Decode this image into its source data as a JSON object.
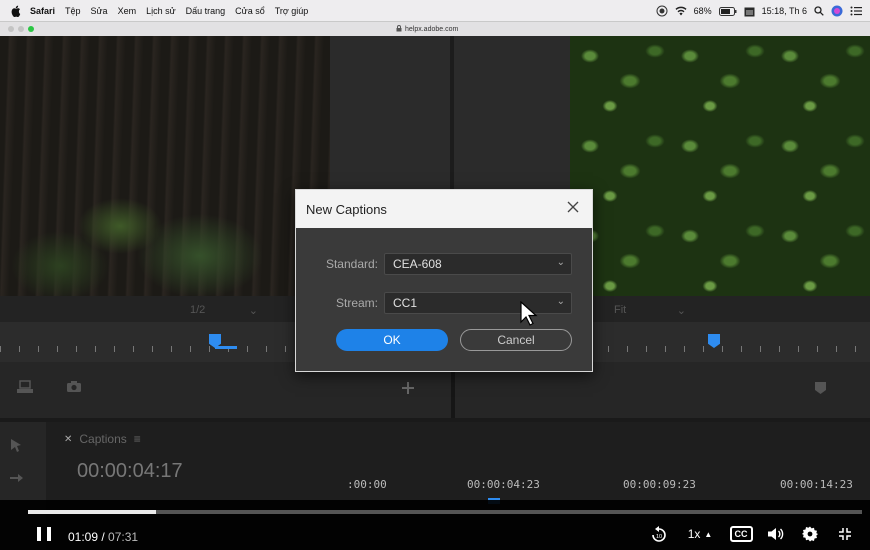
{
  "menubar": {
    "app": "Safari",
    "items": [
      "Tệp",
      "Sửa",
      "Xem",
      "Lịch sử",
      "Dấu trang",
      "Cửa sổ",
      "Trợ giúp"
    ],
    "battery": "68%",
    "clock": "15:18, Th 6"
  },
  "browser": {
    "url": "helpx.adobe.com"
  },
  "editor": {
    "scale_select": "1/2",
    "fit_select": "Fit",
    "captions_tab": "Captions",
    "timecode": "00:00:04:17",
    "timeline_labels": [
      ":00:00",
      "00:00:04:23",
      "00:00:09:23",
      "00:00:14:23"
    ]
  },
  "dialog": {
    "title": "New Captions",
    "standard_label": "Standard:",
    "standard_value": "CEA-608",
    "stream_label": "Stream:",
    "stream_value": "CC1",
    "ok_label": "OK",
    "cancel_label": "Cancel"
  },
  "player": {
    "current_time": "01:09",
    "separator": " / ",
    "duration": "07:31",
    "progress_fraction": 0.153,
    "speed": "1x",
    "cc_label": "CC",
    "rewind_seconds": "10"
  }
}
